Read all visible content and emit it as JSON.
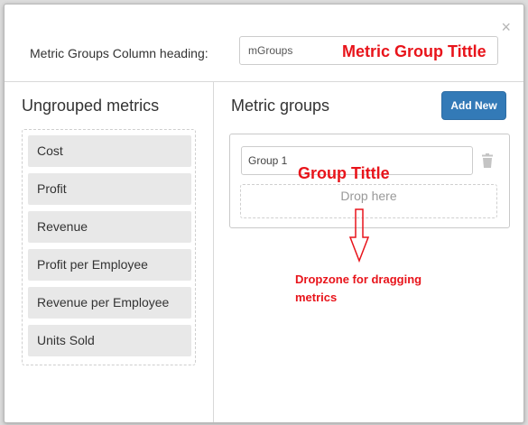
{
  "header": {
    "close_icon": "×",
    "heading_label": "Metric Groups Column heading:",
    "heading_value": "mGroups",
    "annotation": "Metric Group Tittle"
  },
  "left": {
    "title": "Ungrouped metrics",
    "metrics": [
      "Cost",
      "Profit",
      "Revenue",
      "Profit per Employee",
      "Revenue per Employee",
      "Units Sold"
    ]
  },
  "right": {
    "title": "Metric groups",
    "add_button": "Add New",
    "group": {
      "name": "Group 1",
      "annotation": "Group Tittle",
      "dropzone": "Drop here"
    },
    "dropzone_annotation": "Dropzone for dragging\nmetrics"
  },
  "colors": {
    "annotation": "#e8141b",
    "primary_button": "#337ab7",
    "metric_item_bg": "#e8e8e8"
  }
}
